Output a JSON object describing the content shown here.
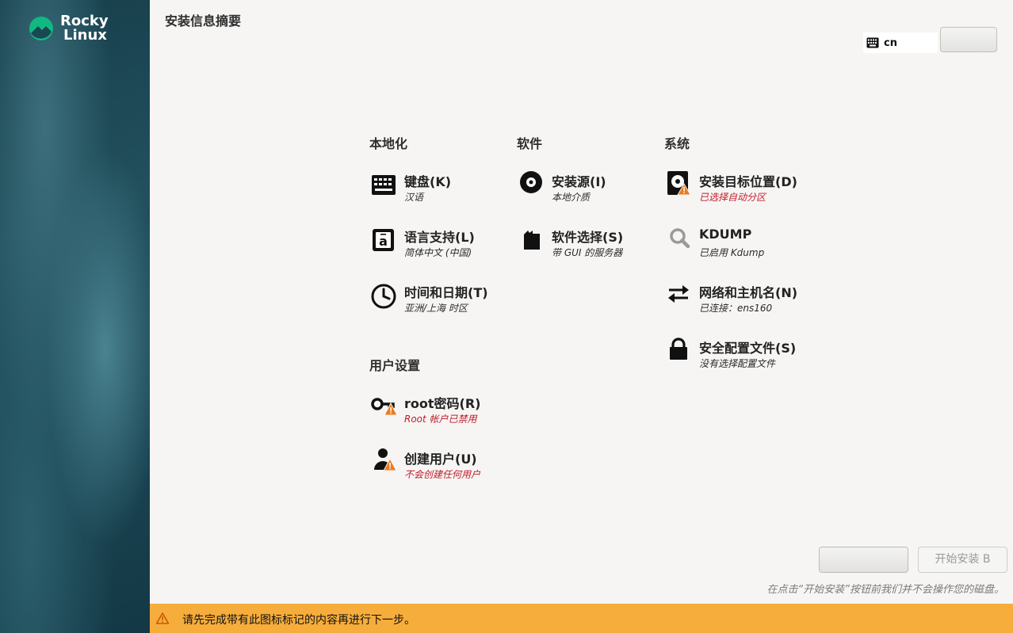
{
  "brand": {
    "line1": "Rocky",
    "line2": "Linux"
  },
  "header": {
    "title": "安装信息摘要"
  },
  "keyboard": {
    "layout": "cn"
  },
  "sections": {
    "localization": "本地化",
    "software": "软件",
    "system": "系统",
    "user": "用户设置"
  },
  "spokes": {
    "keyboard": {
      "label": "键盘(K)",
      "status": "汉语"
    },
    "language": {
      "label": "语言支持(L)",
      "status": "简体中文 (中国)"
    },
    "time": {
      "label": "时间和日期(T)",
      "status": "亚洲/上海 时区"
    },
    "source": {
      "label": "安装源(I)",
      "status": "本地介质"
    },
    "software": {
      "label": "软件选择(S)",
      "status": "带 GUI 的服务器"
    },
    "destination": {
      "label": "安装目标位置(D)",
      "status": "已选择自动分区"
    },
    "kdump": {
      "label": "KDUMP",
      "status": "已启用 Kdump"
    },
    "network": {
      "label": "网络和主机名(N)",
      "status": "已连接：ens160"
    },
    "security": {
      "label": "安全配置文件(S)",
      "status": "没有选择配置文件"
    },
    "root": {
      "label": "root密码(R)",
      "status": "Root 帐户已禁用"
    },
    "user": {
      "label": "创建用户(U)",
      "status": "不会创建任何用户"
    }
  },
  "buttons": {
    "begin": "开始安装 B"
  },
  "bottom_note": "在点击“开始安装”按钮前我们并不会操作您的磁盘。",
  "warning_bar": {
    "text": "请先完成带有此图标标记的内容再进行下一步。"
  },
  "colors": {
    "warning": "#f7ad3b",
    "error_text": "#c01c28",
    "brand_green": "#10b981"
  }
}
